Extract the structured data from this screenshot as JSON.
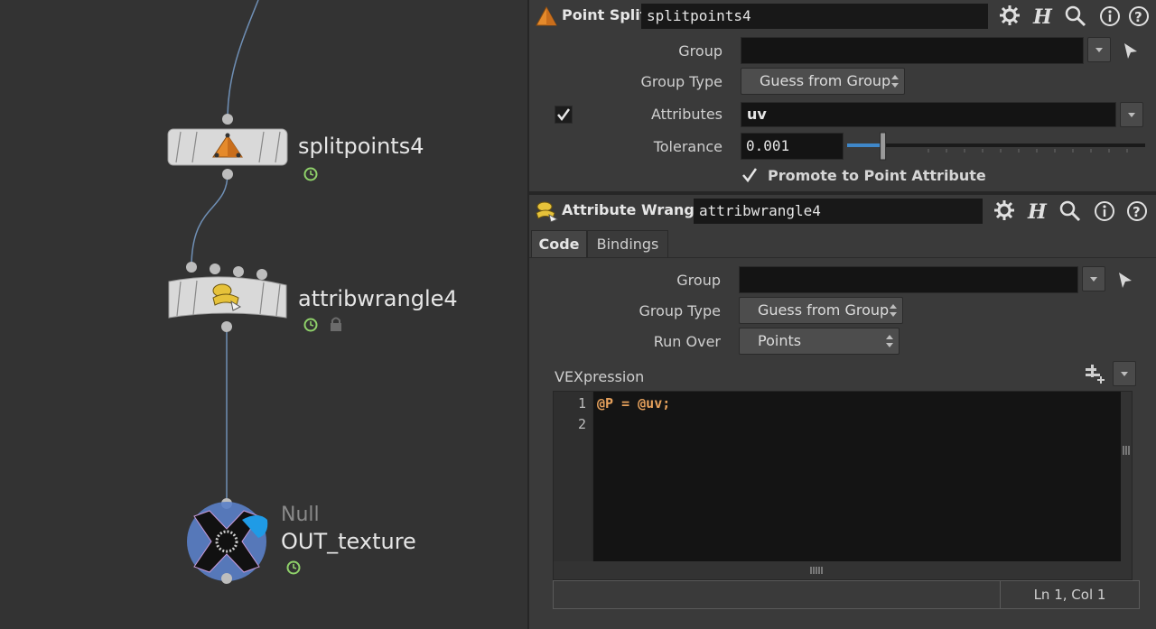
{
  "network": {
    "nodes": [
      {
        "label": "splitpoints4",
        "type": ""
      },
      {
        "label": "attribwrangle4",
        "type": ""
      },
      {
        "label": "OUT_texture",
        "type": "Null"
      }
    ]
  },
  "point_split": {
    "title": "Point Split",
    "name": "splitpoints4",
    "group_label": "Group",
    "group_value": "",
    "group_type_label": "Group Type",
    "group_type_value": "Guess from Group",
    "attributes_label": "Attributes",
    "attributes_value": "uv",
    "attributes_enabled": true,
    "tolerance_label": "Tolerance",
    "tolerance_value": "0.001",
    "tolerance_slider": 0.12,
    "promote_label": "Promote to Point Attribute",
    "promote_checked": true
  },
  "attrib_wrangle": {
    "title": "Attribute Wrangle",
    "name": "attribwrangle4",
    "tabs": [
      {
        "label": "Code",
        "active": true
      },
      {
        "label": "Bindings",
        "active": false
      }
    ],
    "group_label": "Group",
    "group_value": "",
    "group_type_label": "Group Type",
    "group_type_value": "Guess from Group",
    "run_over_label": "Run Over",
    "run_over_value": "Points",
    "vex_label": "VEXpression",
    "code_lines": [
      {
        "num": "1",
        "text": "@P = @uv;"
      },
      {
        "num": "2",
        "text": ""
      }
    ],
    "status": "Ln 1, Col 1"
  },
  "icons": [
    "gear-icon",
    "help-h-icon",
    "search-icon",
    "info-icon",
    "question-icon",
    "pointer-arrow-icon",
    "clock-icon",
    "lock-icon"
  ],
  "colors": {
    "accent_orange": "#e58a2b",
    "code_orange": "#e6a15c",
    "slider_blue": "#3f87c9",
    "clock_green": "#8fd16a",
    "null_blue": "#5a7fc8"
  }
}
